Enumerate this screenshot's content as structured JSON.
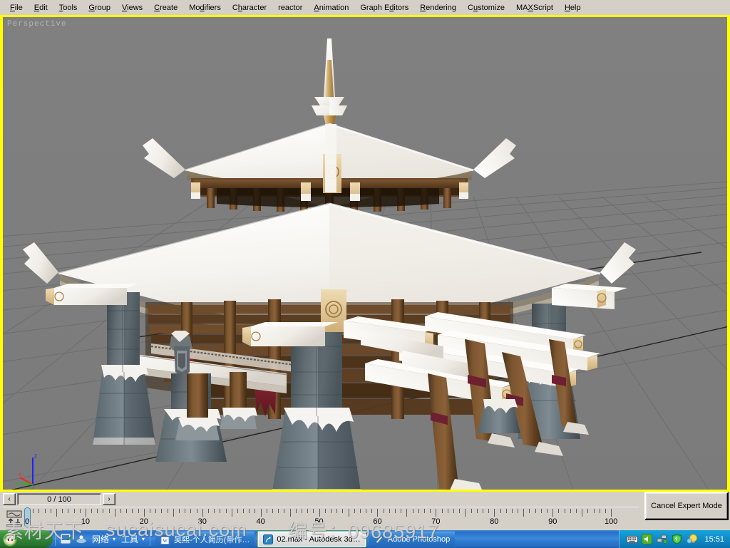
{
  "app": {
    "viewport_label": "Perspective",
    "yellow_border_color": "#ffff00",
    "viewport_bg": "#808080"
  },
  "menubar": {
    "items": [
      {
        "label": "File",
        "accel": "F"
      },
      {
        "label": "Edit",
        "accel": "E"
      },
      {
        "label": "Tools",
        "accel": "T"
      },
      {
        "label": "Group",
        "accel": "G"
      },
      {
        "label": "Views",
        "accel": "V"
      },
      {
        "label": "Create",
        "accel": "C"
      },
      {
        "label": "Modifiers",
        "accel": "d"
      },
      {
        "label": "Character",
        "accel": "h"
      },
      {
        "label": "reactor",
        "accel": ""
      },
      {
        "label": "Animation",
        "accel": "A"
      },
      {
        "label": "Graph Editors",
        "accel": "d"
      },
      {
        "label": "Rendering",
        "accel": "R"
      },
      {
        "label": "Customize",
        "accel": "u"
      },
      {
        "label": "MAXScript",
        "accel": "X"
      },
      {
        "label": "Help",
        "accel": "H"
      }
    ]
  },
  "timefield": {
    "prev_label": "‹",
    "next_label": "›",
    "value": "0 / 100"
  },
  "trackbar": {
    "current_frame": 0,
    "frame_start": 0,
    "frame_end": 100,
    "tick_labels": [
      "10",
      "20",
      "30",
      "40",
      "50",
      "60",
      "70",
      "80",
      "90",
      "100"
    ],
    "tick_values": [
      10,
      20,
      30,
      40,
      50,
      60,
      70,
      80,
      90,
      100
    ],
    "keymode_icon": "key-mode-toggle-icon"
  },
  "expert_mode": {
    "cancel_label": "Cancel Expert Mode"
  },
  "watermark": {
    "part1": "素材天下",
    "part2": "sucaisucai.com",
    "part3": "编号：09685917"
  },
  "taskbar": {
    "start_label": "",
    "quicklaunch": [
      {
        "name": "show-desktop-icon"
      },
      {
        "name": "explorer-icon"
      }
    ],
    "menus": [
      {
        "label": "网络",
        "arrow": "▾"
      },
      {
        "label": "工具",
        "arrow": "▾"
      }
    ],
    "buttons": [
      {
        "label": "吴熙-个人简历(带作…",
        "icon": "word-document-icon",
        "active": false
      },
      {
        "label": "02.max - Autodesk 3d…",
        "icon": "3dsmax-icon",
        "active": true
      },
      {
        "label": "Adobe Photoshop",
        "icon": "photoshop-icon",
        "active": false
      }
    ],
    "tray": [
      {
        "name": "keyboard-layout-icon"
      },
      {
        "name": "volume-icon"
      },
      {
        "name": "network-icon"
      },
      {
        "name": "shield-security-icon"
      },
      {
        "name": "notification-bulb-icon"
      }
    ],
    "clock": "15:51"
  },
  "axis_tripod": {
    "x_label": "x",
    "y_label": "y",
    "z_label": "z",
    "x_color": "#ff2020",
    "y_color": "#18c018",
    "z_color": "#2020ff"
  },
  "scene": {
    "description": "Snow-covered oriental pagoda temple, 3D model in perspective viewport",
    "colors": {
      "snow": "#f4f2ee",
      "snow_shadow": "#ddd9d2",
      "wood_dark": "#5a3d24",
      "wood_mid": "#7a5435",
      "wood_light": "#a87a4c",
      "wood_end": "#e0c79a",
      "stone_dark": "#4a5458",
      "stone_mid": "#68747a",
      "stone_light": "#8d979b",
      "banner_red": "#7d2230",
      "grid_line": "#6e6e6e"
    }
  }
}
